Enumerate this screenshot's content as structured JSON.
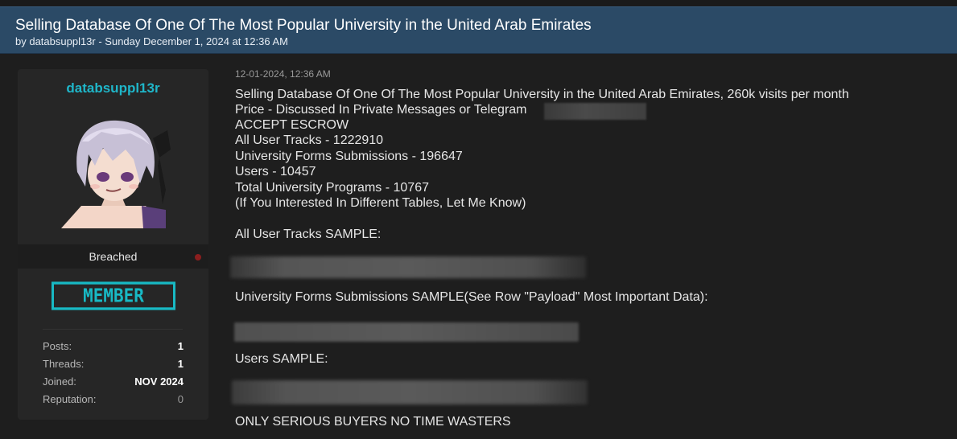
{
  "thread": {
    "title": "Selling Database Of One Of The Most Popular University in the United Arab Emirates",
    "byline": "by databsuppl13r - Sunday December 1, 2024 at 12:36 AM"
  },
  "user": {
    "username": "databsuppl13r",
    "avatar_icon": "anime-avatar",
    "rank": "Breached",
    "badge": "MEMBER",
    "stats": [
      {
        "key": "Posts:",
        "value": "1"
      },
      {
        "key": "Threads:",
        "value": "1"
      },
      {
        "key": "Joined:",
        "value": "NOV 2024"
      },
      {
        "key": "Reputation:",
        "value": "0"
      }
    ]
  },
  "post": {
    "date": "12-01-2024, 12:36 AM",
    "lines": [
      "Selling Database Of One Of The Most Popular University in the United Arab Emirates, 260k visits per month",
      "Price - Discussed In Private Messages or Telegram",
      "ACCEPT ESCROW",
      "All User Tracks - 1222910",
      "University Forms Submissions - 196647",
      "Users - 10457",
      "Total University Programs - 10767",
      "(If You Interested In Different Tables, Let Me Know)"
    ],
    "sample1_label": "All User Tracks SAMPLE:",
    "sample2_label": "University Forms Submissions SAMPLE(See Row \"Payload\" Most Important Data):",
    "sample3_label": "Users SAMPLE:",
    "closing": "ONLY SERIOUS BUYERS NO TIME WASTERS"
  },
  "colors": {
    "header_bg": "#2b4a66",
    "username": "#1fb6c9",
    "badge": "#18b9c4",
    "status_dot": "#8b1e1e"
  }
}
